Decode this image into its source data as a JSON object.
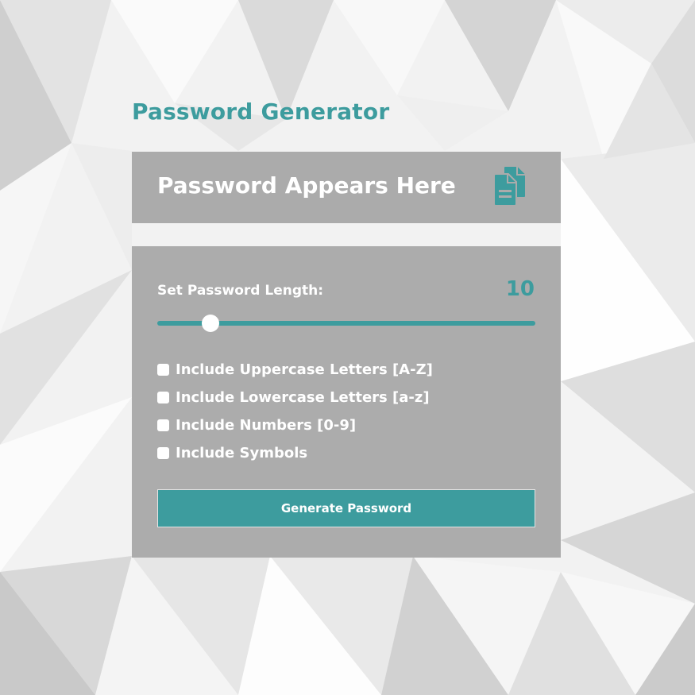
{
  "app": {
    "title": "Password Generator"
  },
  "display": {
    "password_text": "Password Appears Here",
    "copy_icon": "copy-documents-icon"
  },
  "length": {
    "label": "Set Password Length:",
    "value": "10",
    "slider_fraction": 0.14
  },
  "options": [
    {
      "label": "Include Uppercase Letters [A-Z]",
      "checked": false
    },
    {
      "label": "Include Lowercase Letters [a-z]",
      "checked": false
    },
    {
      "label": "Include Numbers [0-9]",
      "checked": false
    },
    {
      "label": "Include Symbols",
      "checked": false
    }
  ],
  "actions": {
    "generate_label": "Generate Password"
  },
  "colors": {
    "accent": "#3d9c9e",
    "panel": "#acacac",
    "text": "#ffffff"
  }
}
